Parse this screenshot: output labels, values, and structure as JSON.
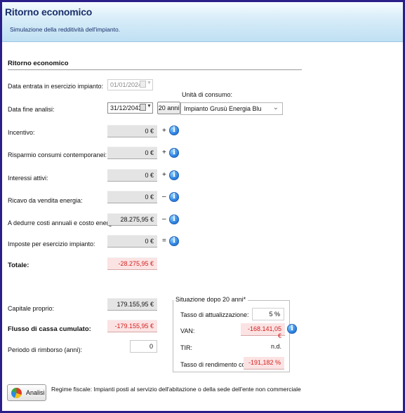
{
  "header": {
    "title": "Ritorno economico",
    "subtitle": "Simulazione della redditività dell'impianto."
  },
  "section": {
    "title": "Ritorno economico"
  },
  "dates": {
    "start_label": "Data entrata in esercizio impianto:",
    "start_value": "01/01/2024",
    "end_label": "Data fine analisi:",
    "end_value": "31/12/2043",
    "years_button": "20 anni",
    "calendar_icon": "calendar-icon"
  },
  "consumption_unit": {
    "label": "Unità di consumo:",
    "selected": "Impianto Grusù Energia Blu",
    "icon": "chevron-down-icon"
  },
  "rows": [
    {
      "label": "Incentivo:",
      "value": "0 €",
      "op": "+"
    },
    {
      "label": "Risparmio consumi contemporanei:",
      "value": "0 €",
      "op": "+"
    },
    {
      "label": "Interessi attivi:",
      "value": "0 €",
      "op": "+"
    },
    {
      "label": "Ricavo da vendita energia:",
      "value": "0 €",
      "op": "–"
    },
    {
      "label": "A dedurre costi annuali e costo energia:",
      "value": "28.275,95 €",
      "op": "–"
    },
    {
      "label": "Imposte per esercizio impianto:",
      "value": "0 €",
      "op": "="
    }
  ],
  "total": {
    "label": "Totale:",
    "value": "-28.275,95 €"
  },
  "capital": {
    "label": "Capitale proprio:",
    "value": "179.155,95 €"
  },
  "cashflow": {
    "label": "Flusso di cassa cumulato:",
    "value": "-179.155,95 €"
  },
  "payback": {
    "label": "Periodo di rimborso (anni):",
    "value": "0"
  },
  "situation": {
    "title": "Situazione dopo 20 anni*",
    "discount_label": "Tasso di attualizzazione:",
    "discount_value": "5 %",
    "van_label": "VAN:",
    "van_value": "-168.141,05 €",
    "tir_label": "TIR:",
    "tir_value": "n.d.",
    "compound_label": "Tasso di rendimento composto:",
    "compound_value": "-191,182 %"
  },
  "footer": {
    "analysis_button": "Analisi",
    "regime": "Regime fiscale: Impianti posti al servizio dell'abitazione o della sede dell'ente non commerciale"
  },
  "colors": {
    "accent": "#2a1e8a",
    "negative": "#d41e1e",
    "info": "#2f86e2"
  }
}
